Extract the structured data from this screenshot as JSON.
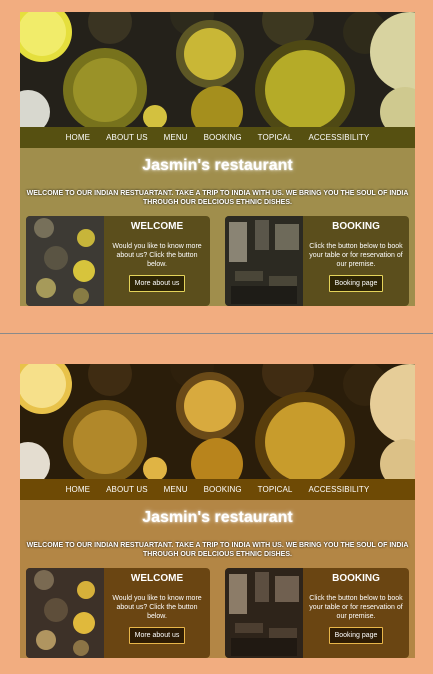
{
  "colors": {
    "background": "#f2ad80",
    "nav_top": "#565011",
    "nav_bottom": "#6e4a05",
    "accent_top": "#a08e4c",
    "accent_bottom": "#b38645"
  },
  "frames": [
    {
      "nav": [
        "HOME",
        "ABOUT US",
        "MENU",
        "BOOKING",
        "TOPICAL",
        "ACCESSIBILITY"
      ],
      "title": "Jasmin's restaurant",
      "welcome": "WELCOME TO OUR INDIAN RESTUARTANT. TAKE A TRIP TO INDIA WITH US. WE BRING YOU THE SOUL OF INDIA THROUGH OUR DELCIOUS ETHNIC DISHES.",
      "cards": [
        {
          "title": "WELCOME",
          "text": "Would you like to know more about us? Click the button below.",
          "button": "More about us",
          "image_icon": "spices-image"
        },
        {
          "title": "BOOKING",
          "text": "Click the button below to book your table or for reservation of our premise.",
          "button": "Booking page",
          "image_icon": "restaurant-interior-image"
        }
      ]
    },
    {
      "nav": [
        "HOME",
        "ABOUT US",
        "MENU",
        "BOOKING",
        "TOPICAL",
        "ACCESSIBILITY"
      ],
      "title": "Jasmin's restaurant",
      "welcome": "WELCOME TO OUR INDIAN RESTUARTANT. TAKE A TRIP TO INDIA WITH US. WE BRING YOU THE SOUL OF INDIA THROUGH OUR DELCIOUS ETHNIC DISHES.",
      "cards": [
        {
          "title": "WELCOME",
          "text": "Would you like to know more about us? Click the button below.",
          "button": "More about us",
          "image_icon": "spices-image"
        },
        {
          "title": "BOOKING",
          "text": "Click the button below to book your table or for reservation of our premise.",
          "button": "Booking page",
          "image_icon": "restaurant-interior-image"
        }
      ]
    }
  ]
}
